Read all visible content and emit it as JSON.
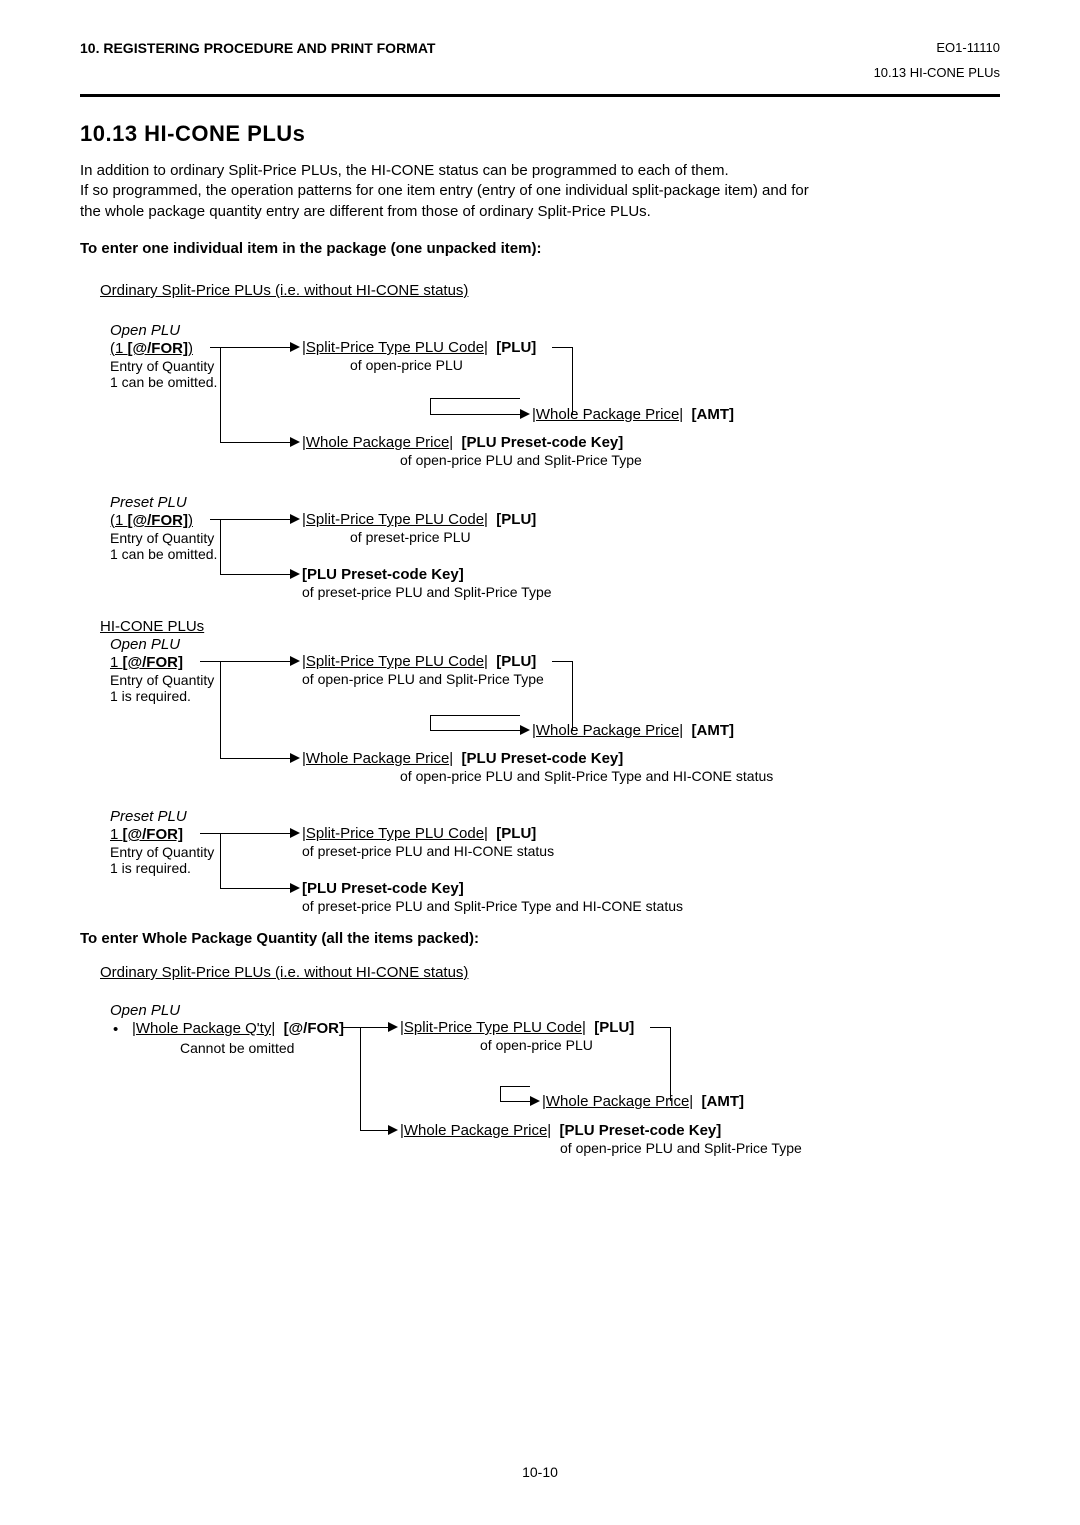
{
  "header": {
    "chapter": "10. REGISTERING PROCEDURE AND PRINT FORMAT",
    "docid": "EO1-11110",
    "section_ref": "10.13  HI-CONE PLUs"
  },
  "title": "10.13  HI-CONE PLUs",
  "intro_l1": "In addition to ordinary Split-Price PLUs, the HI-CONE status can be programmed to each of them.",
  "intro_l2": "If so programmed, the operation patterns for one item entry (entry of one individual split-package item) and for",
  "intro_l3": "the whole package quantity entry are different from those of ordinary Split-Price PLUs.",
  "sub1": "To enter one individual item in the package (one unpacked item):",
  "ord_label": "Ordinary Split-Price PLUs (i.e. without HI-CONE status)",
  "hicone_label": "HI-CONE PLUs",
  "open_plu": "Open PLU",
  "preset_plu": "Preset PLU",
  "at_for": "[@/FOR]",
  "one_prefix": "1  ",
  "one_paren_pre": "(",
  "one_paren_post": ")",
  "eq_omit_l1": "Entry of Quantity",
  "eq_omit_l2": "1 can be omitted.",
  "eq_req_l2": "1 is required.",
  "split_code": "|Split-Price Type PLU Code|",
  "plu_key": "[PLU]",
  "of_open": "of open-price PLU",
  "of_preset": "of preset-price PLU",
  "of_open_split": "of open-price PLU and Split-Price Type",
  "of_preset_split": "of preset-price PLU and Split-Price Type",
  "of_preset_hicone": "of preset-price PLU and HI-CONE status",
  "of_open_split_hicone": "of open-price PLU and Split-Price Type and HI-CONE status",
  "of_preset_split_hicone": "of preset-price PLU and Split-Price Type and HI-CONE status",
  "whole_price": "|Whole Package Price|",
  "amt": "[AMT]",
  "presetcode_key": "[PLU Preset-code Key]",
  "sub2": "To enter Whole Package Quantity (all the items packed):",
  "whole_qty": "|Whole Package Q'ty|",
  "cannot_omit": "Cannot be omitted",
  "bullet": "•",
  "pagenum": "10-10"
}
